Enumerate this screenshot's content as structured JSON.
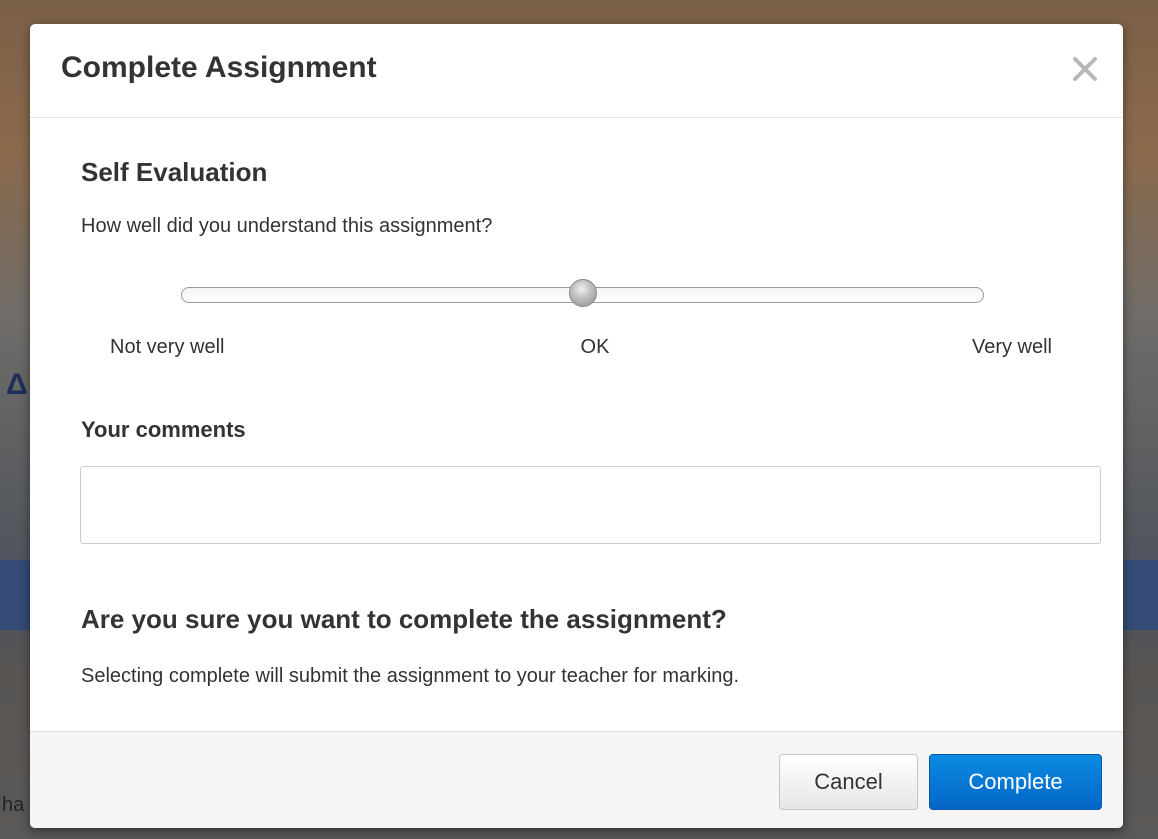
{
  "background": {
    "glyph": "Δ",
    "partial_text": "ha"
  },
  "modal": {
    "title": "Complete Assignment",
    "close_icon": "close-icon"
  },
  "self_evaluation": {
    "heading": "Self Evaluation",
    "question": "How well did you understand this assignment?",
    "slider": {
      "min_label": "Not very well",
      "mid_label": "OK",
      "max_label": "Very well",
      "value_fraction": 0.5
    }
  },
  "comments": {
    "heading": "Your comments",
    "value": "",
    "placeholder": ""
  },
  "confirm": {
    "heading": "Are you sure you want to complete the assignment?",
    "text": "Selecting complete will submit the assignment to your teacher for marking."
  },
  "footer": {
    "cancel_label": "Cancel",
    "complete_label": "Complete"
  },
  "colors": {
    "primary": "#0a77d5",
    "text": "#333333"
  }
}
